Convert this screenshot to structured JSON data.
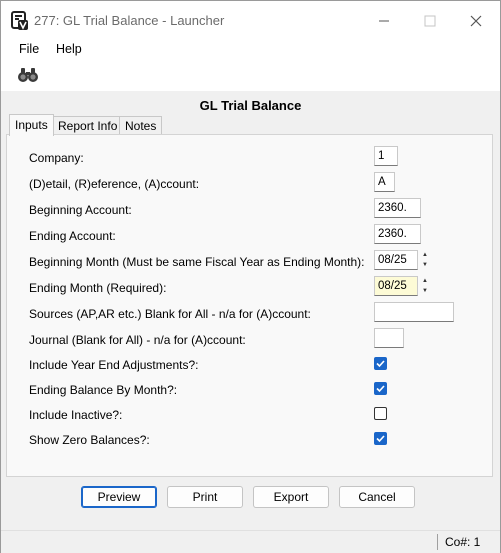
{
  "window": {
    "title": "277: GL Trial Balance - Launcher"
  },
  "menu": {
    "items": [
      "File",
      "Help"
    ]
  },
  "heading": "GL Trial Balance",
  "tabs": [
    "Inputs",
    "Report Info",
    "Notes"
  ],
  "fields": [
    {
      "label": "Company:",
      "value": "1"
    },
    {
      "label": "(D)etail, (R)eference, (A)ccount:",
      "value": "A"
    },
    {
      "label": "Beginning Account:",
      "value": "2360."
    },
    {
      "label": "Ending Account:",
      "value": "2360."
    },
    {
      "label": "Beginning Month (Must be same Fiscal Year as Ending Month):",
      "value": "08/25"
    },
    {
      "label": "Ending Month (Required):",
      "value": "08/25"
    },
    {
      "label": "Sources (AP,AR etc.) Blank for All - n/a for (A)ccount:",
      "value": ""
    },
    {
      "label": "Journal (Blank for All) - n/a for (A)ccount:",
      "value": ""
    }
  ],
  "checks": [
    {
      "label": "Include Year End Adjustments?:",
      "checked": true
    },
    {
      "label": "Ending Balance By Month?:",
      "checked": true
    },
    {
      "label": "Include Inactive?:",
      "checked": false
    },
    {
      "label": "Show Zero Balances?:",
      "checked": true
    }
  ],
  "buttons": {
    "preview": "Preview",
    "print": "Print",
    "export": "Export",
    "cancel": "Cancel"
  },
  "status": {
    "company": "Co#: 1"
  },
  "colors": {
    "accent": "#1a66c9",
    "highlight_field": "#fdfbd6"
  }
}
